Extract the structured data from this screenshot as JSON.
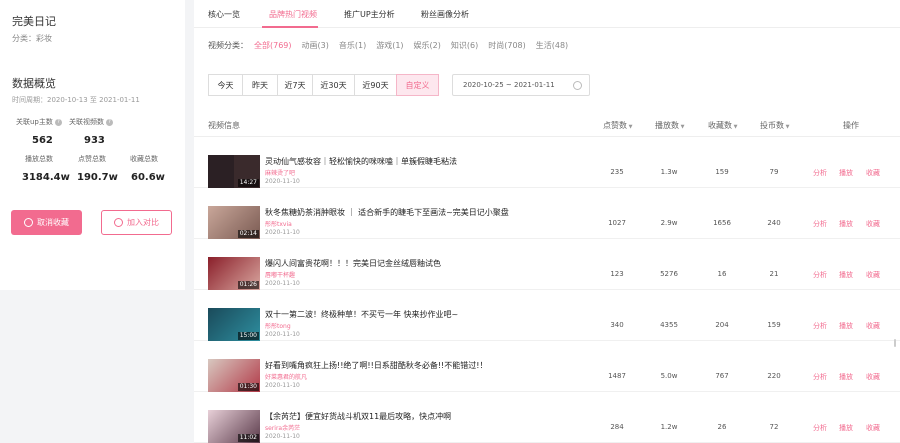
{
  "brand": {
    "name": "完美日记",
    "category": "分类：彩妆"
  },
  "overview": {
    "title": "数据概览",
    "period": "时间周期：2020-10-13 至 2021-01-11",
    "stats": [
      {
        "label": "关联up主数",
        "value": "562"
      },
      {
        "label": "关联视频数",
        "value": "933"
      },
      {
        "label": "播放总数",
        "value": "3184.4w"
      },
      {
        "label": "点赞总数",
        "value": "190.7w"
      },
      {
        "label": "收藏总数",
        "value": "60.6w"
      }
    ]
  },
  "buttons": {
    "unfavorite": "取消收藏",
    "compare": "加入对比"
  },
  "tabs": [
    "核心一览",
    "品牌热门视频",
    "推广UP主分析",
    "粉丝画像分析"
  ],
  "categories": {
    "label": "视频分类：",
    "items": [
      "全部(769)",
      "动画(3)",
      "音乐(1)",
      "游戏(1)",
      "娱乐(2)",
      "知识(6)",
      "时尚(708)",
      "生活(48)"
    ]
  },
  "date_filters": [
    "今天",
    "昨天",
    "近7天",
    "近30天",
    "近90天",
    "自定义"
  ],
  "date_range": "2020-10-25 ~ 2021-01-11",
  "table": {
    "headers": {
      "info": "视频信息",
      "likes": "点赞数",
      "plays": "播放数",
      "favs": "收藏数",
      "coins": "投币数",
      "ops": "操作"
    },
    "ops": [
      "分析",
      "播放",
      "收藏"
    ],
    "rows": [
      {
        "title": "灵动仙气感妆容｜轻松愉快的咪咪嗑｜单簇假睫毛粘法",
        "author": "麻辣烫了吧",
        "date": "2020-11-10",
        "duration": "14:27",
        "likes": "235",
        "plays": "1.3w",
        "favs": "159",
        "coins": "79"
      },
      {
        "title": "秋冬焦糖奶茶消肿眼妆 ｜ 适合新手的睫毛下至画法~完美日记小聚盘",
        "author": "彤彤txvia",
        "date": "2020-11-10",
        "duration": "02:14",
        "likes": "1027",
        "plays": "2.9w",
        "favs": "1656",
        "coins": "240"
      },
      {
        "title": "爆闪人间富贵花啊！！！完美日记金丝绒唇釉试色",
        "author": "唇嘟干杯趣",
        "date": "2020-11-10",
        "duration": "01:26",
        "likes": "123",
        "plays": "5276",
        "favs": "16",
        "coins": "21"
      },
      {
        "title": "双十一第二波！终极种草！不买亏一年 快来抄作业吧~",
        "author": "彤彤tong",
        "date": "2020-11-10",
        "duration": "15:00",
        "likes": "340",
        "plays": "4355",
        "favs": "204",
        "coins": "159"
      },
      {
        "title": "好看到嘴角疯狂上扬!!绝了啊!!日系甜酷秋冬必备!!不能错过!！",
        "author": "好菜惠君的航凡",
        "date": "2020-11-10",
        "duration": "01:30",
        "likes": "1487",
        "plays": "5.0w",
        "favs": "767",
        "coins": "220"
      },
      {
        "title": "【余芮茫】便宜好货战斗机双11最后攻略，快点冲啊",
        "author": "serira余芮茫",
        "date": "2020-11-10",
        "duration": "11:02",
        "likes": "284",
        "plays": "1.2w",
        "favs": "26",
        "coins": "72"
      }
    ]
  },
  "colors": {
    "accent": "#f26b8f",
    "background": "#f3f4f6"
  }
}
